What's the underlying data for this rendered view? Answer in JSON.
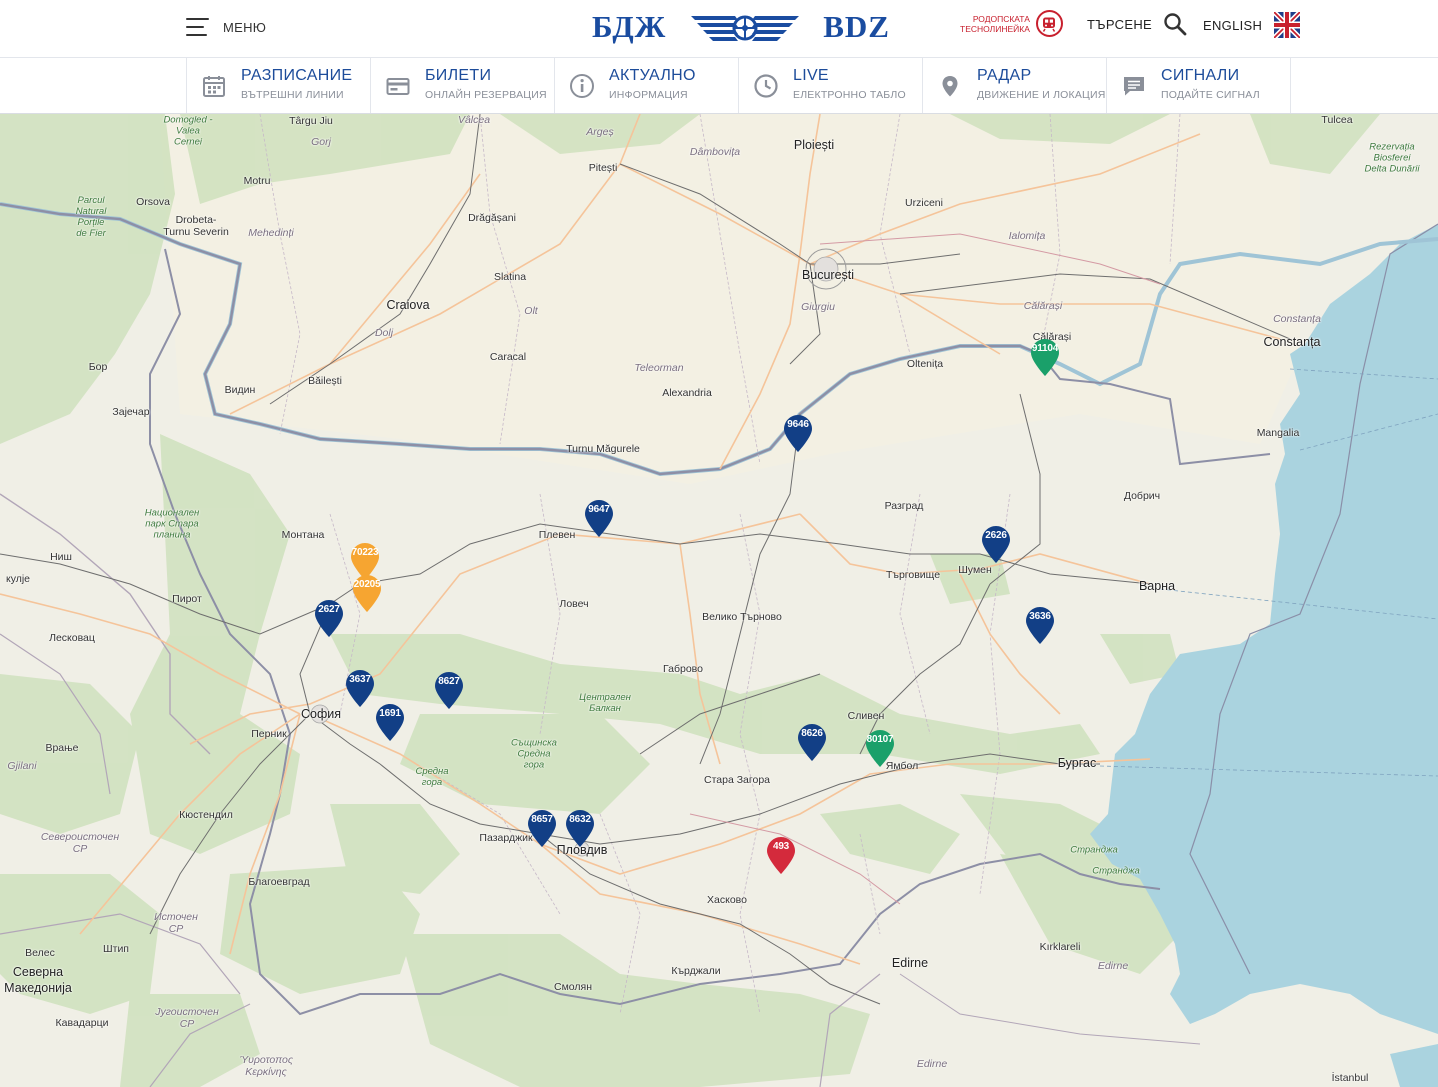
{
  "header": {
    "menu_label": "МЕНЮ",
    "logo_left": "БДЖ",
    "logo_right": "BDZ",
    "rhodope_line1": "РОДОПСКАТА",
    "rhodope_line2": "ТЕСНОЛИНЕЙКА",
    "search_label": "ТЪРСЕНЕ",
    "language_label": "ENGLISH",
    "brand_color": "#1a4ca0"
  },
  "nav": [
    {
      "title": "РАЗПИСАНИЕ",
      "subtitle": "ВЪТРЕШНИ ЛИНИИ",
      "icon": "calendar-icon"
    },
    {
      "title": "БИЛЕТИ",
      "subtitle": "ОНЛАЙН РЕЗЕРВАЦИЯ",
      "icon": "ticket-icon"
    },
    {
      "title": "АКТУАЛНО",
      "subtitle": "ИНФОРМАЦИЯ",
      "icon": "info-icon"
    },
    {
      "title": "LIVE",
      "subtitle": "ЕЛЕКТРОННО ТАБЛО",
      "icon": "clock-icon"
    },
    {
      "title": "РАДАР",
      "subtitle": "ДВИЖЕНИЕ И ЛОКАЦИЯ",
      "icon": "location-pin-icon"
    },
    {
      "title": "СИГНАЛИ",
      "subtitle": "ПОДАЙТЕ СИГНАЛ",
      "icon": "message-icon"
    }
  ],
  "map": {
    "places": {
      "bucuresti": "București",
      "craiova": "Craiova",
      "ploiesti": "Ploiești",
      "constanta": "Constanța",
      "sofia": "София",
      "plovdiv": "Пловдив",
      "varna": "Варна",
      "burgas": "Бургас",
      "edirne": "Edirne",
      "pleven": "Плевен",
      "vidin": "Видин",
      "montana": "Монтана",
      "lovech": "Ловеч",
      "vtarnovo": "Велико Търново",
      "gabrovo": "Габрово",
      "stara_zagora": "Стара Загора",
      "sliven": "Сливен",
      "yambol": "Ямбол",
      "shumen": "Шумен",
      "targovishte": "Търговище",
      "razgrad": "Разград",
      "dobrich": "Добрич",
      "haskovo": "Хасково",
      "kardzhali": "Кърджали",
      "smolyan": "Смолян",
      "pazardzhik": "Пазарджик",
      "blagoevgrad": "Благоевград",
      "kyustendil": "Кюстендил",
      "pernik": "Перник",
      "pirot": "Пирот",
      "nish": "Ниш",
      "leskovac": "Лесковац",
      "vranje": "Врање",
      "zajecar": "Зајечар",
      "bor": "Бор",
      "alexandria": "Alexandria",
      "giurgiu": "Giurgiu",
      "oltenita": "Oltenița",
      "calarasi": "Călărași",
      "calarasi_region": "Călărași",
      "mangalia": "Mangalia",
      "turnu_magurele": "Turnu Măgurele",
      "caracal": "Caracal",
      "slatina": "Slatina",
      "pitesti": "Pitești",
      "targu_jiu": "Târgu Jiu",
      "drobeta": "Drobeta-\nTurnu Severin",
      "orsova": "Orsova",
      "motru": "Motru",
      "bailesti": "Băilești",
      "dragasani": "Drăgășani",
      "urziceni": "Urziceni",
      "tulcea": "Tulcea",
      "kirklareli": "Kırklareli",
      "edirne_region": "Edirne",
      "istanbul": "İstanbul",
      "veles": "Велес",
      "shtip": "Штип",
      "kavadarci": "Кавадарци",
      "gjilani": "Gjilani",
      "kumanovo": "кулје",
      "severna_makedonia": "Северна\nМакедонија",
      "teleorman": "Teleorman",
      "olt": "Olt",
      "dolj": "Dolj",
      "ialomita": "Ialomița",
      "dambovita": "Dâmbovița",
      "arges": "Argeș",
      "valcea": "Vâlcea",
      "gorj": "Gorj",
      "mehedinti": "Mehedinți",
      "domagled": "Domogled -\nValea\nCernei",
      "portile": "Parcul\nNatural\nPorțile\nde Fier",
      "delta": "Rezervația\nBiosferei\nDelta Dunării",
      "stara_planina": "Национален\nпарк Стара\nпланина",
      "centralen_balkan": "Централен\nБалкан",
      "sredna_gora1": "Същинска\nСредна\nгора",
      "sredna_gora2": "Средна\nгора",
      "strandzha1": "Странджа",
      "strandzha2": "Странджа",
      "severoistochen": "Североисточен\nСР",
      "istochen": "Источен\nСР",
      "jugoistochen": "Југоисточен\nСР",
      "yrotopos": "Ύυροτοπος\nΚερκίνης"
    },
    "trains": [
      {
        "id": "91104",
        "color": "#1aa06a"
      },
      {
        "id": "9646",
        "color": "#123f86"
      },
      {
        "id": "9647",
        "color": "#123f86"
      },
      {
        "id": "2626",
        "color": "#123f86"
      },
      {
        "id": "70223",
        "color": "#f6a531"
      },
      {
        "id": "20205",
        "color": "#f6a531"
      },
      {
        "id": "2627",
        "color": "#123f86"
      },
      {
        "id": "3636",
        "color": "#123f86"
      },
      {
        "id": "3637",
        "color": "#123f86"
      },
      {
        "id": "8627",
        "color": "#123f86"
      },
      {
        "id": "1691",
        "color": "#123f86"
      },
      {
        "id": "8626",
        "color": "#123f86"
      },
      {
        "id": "80107",
        "color": "#1aa06a"
      },
      {
        "id": "8657",
        "color": "#123f86"
      },
      {
        "id": "8632",
        "color": "#123f86"
      },
      {
        "id": "493",
        "color": "#d42a3c"
      }
    ]
  }
}
